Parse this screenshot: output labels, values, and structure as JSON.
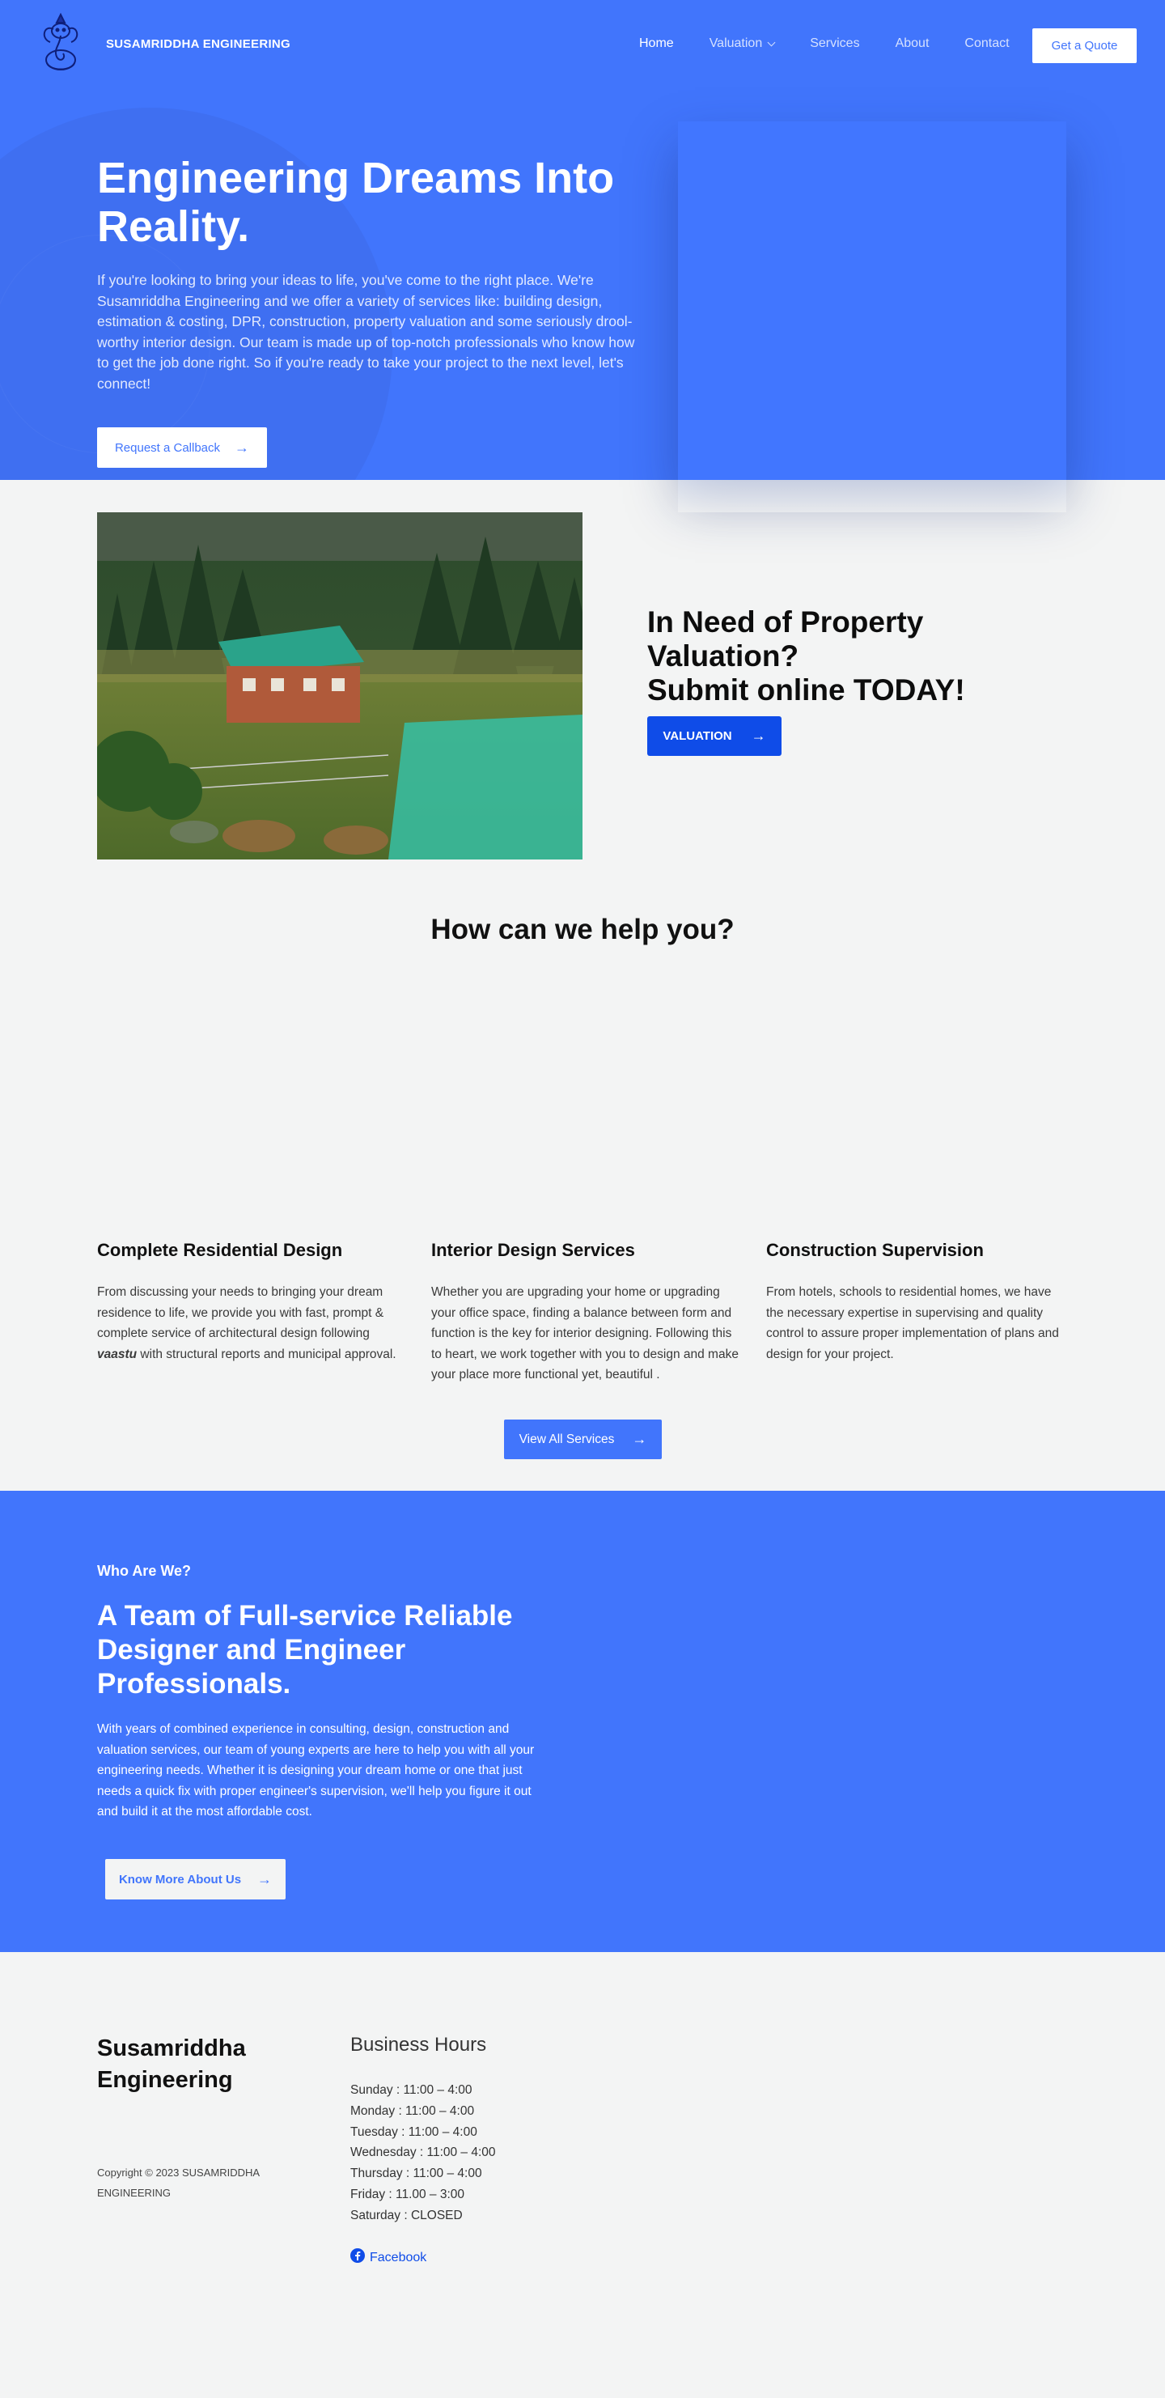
{
  "header": {
    "brand": "SUSAMRIDDHA ENGINEERING",
    "nav": [
      {
        "label": "Home",
        "active": true
      },
      {
        "label": "Valuation",
        "active": false,
        "has_dropdown": true
      },
      {
        "label": "Services",
        "active": false
      },
      {
        "label": "About",
        "active": false
      },
      {
        "label": "Contact",
        "active": false
      }
    ],
    "cta": "Get a Quote"
  },
  "hero": {
    "title": "Engineering Dreams Into Reality.",
    "text": "If you're looking to bring your ideas to life, you've come to the right place. We're Susamriddha Engineering and we offer a variety of services like: building design, estimation & costing, DPR, construction, property valuation and some seriously drool-worthy interior design. Our team is made up of top-notch professionals who know how to get the job done right. So if you're ready to take your project to the next level, let's connect!",
    "button": "Request a Callback"
  },
  "valuation": {
    "title_line1": "In Need of Property Valuation?",
    "title_line2": "Submit online TODAY!",
    "button": "VALUATION"
  },
  "services": {
    "title": "How can we help you?",
    "items": [
      {
        "title": "Complete Residential Design",
        "text_before": "From discussing your needs to bringing your dream residence to life, we provide you with fast, prompt & complete service of architectural design following ",
        "text_emphasis": "vaastu",
        "text_after": " with structural reports and municipal approval."
      },
      {
        "title": "Interior Design Services",
        "text": "Whether you are upgrading your home or upgrading your office space, finding a balance between form and function is the key for interior designing. Following this to heart, we work together with you to design and make your place more functional yet, beautiful ."
      },
      {
        "title": "Construction Supervision",
        "text": "From hotels, schools to residential homes, we have the necessary expertise in supervising and quality control to assure proper implementation of plans and design for your project."
      }
    ],
    "button": "View All Services"
  },
  "about": {
    "label": "Who Are We?",
    "title": "A Team of Full-service Reliable Designer and Engineer Professionals.",
    "text": "With years of combined experience in consulting, design, construction and valuation services, our team of young experts are here to help you with all your engineering needs. Whether it is designing your dream home or one that just needs a quick fix with proper engineer's supervision, we'll help you figure it out and build it at the most affordable cost.",
    "button": "Know More About Us"
  },
  "footer": {
    "brand": "Susamriddha Engineering",
    "copyright": "Copyright © 2023 SUSAMRIDDHA ENGINEERING",
    "hours_title": "Business Hours",
    "hours": [
      "Sunday : 11:00 – 4:00",
      "Monday : 11:00 – 4:00",
      "Tuesday : 11:00 – 4:00",
      "Wednesday : 11:00 – 4:00",
      "Thursday : 11:00 – 4:00",
      "Friday : 11.00 – 3:00",
      "Saturday : CLOSED"
    ],
    "social": "Facebook"
  },
  "colors": {
    "primary": "#4175fc",
    "dark_button": "#0f4ce8",
    "background": "#f3f4f4"
  }
}
